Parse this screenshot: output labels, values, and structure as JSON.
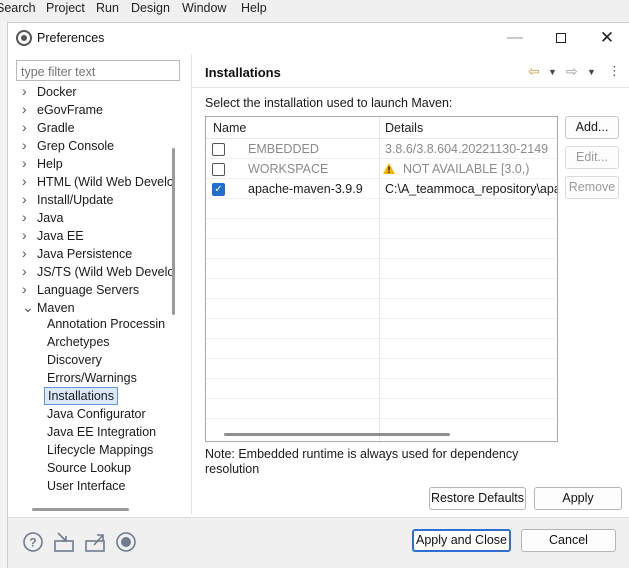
{
  "background_menu": [
    "Search",
    "Project",
    "Run",
    "Design",
    "Window",
    "Help"
  ],
  "window": {
    "title": "Preferences"
  },
  "filter": {
    "placeholder": "type filter text"
  },
  "tree": [
    {
      "label": "Docker",
      "expandable": true
    },
    {
      "label": "eGovFrame",
      "expandable": true
    },
    {
      "label": "Gradle",
      "expandable": true
    },
    {
      "label": "Grep Console",
      "expandable": true
    },
    {
      "label": "Help",
      "expandable": true
    },
    {
      "label": "HTML (Wild Web Develo",
      "expandable": true
    },
    {
      "label": "Install/Update",
      "expandable": true
    },
    {
      "label": "Java",
      "expandable": true
    },
    {
      "label": "Java EE",
      "expandable": true
    },
    {
      "label": "Java Persistence",
      "expandable": true
    },
    {
      "label": "JS/TS (Wild Web Develo",
      "expandable": true
    },
    {
      "label": "Language Servers",
      "expandable": true
    },
    {
      "label": "Maven",
      "expanded": true
    },
    {
      "label": "Annotation Processin",
      "child": true
    },
    {
      "label": "Archetypes",
      "child": true
    },
    {
      "label": "Discovery",
      "child": true
    },
    {
      "label": "Errors/Warnings",
      "child": true
    },
    {
      "label": "Installations",
      "child": true,
      "selected": true
    },
    {
      "label": "Java Configurator",
      "child": true
    },
    {
      "label": "Java EE Integration",
      "child": true
    },
    {
      "label": "Lifecycle Mappings",
      "child": true
    },
    {
      "label": "Source Lookup",
      "child": true
    },
    {
      "label": "User Interface",
      "child": true
    }
  ],
  "page": {
    "title": "Installations",
    "description": "Select the installation used to launch Maven:",
    "table": {
      "columns": [
        "Name",
        "Details"
      ],
      "rows": [
        {
          "checked": false,
          "name": "EMBEDDED",
          "details": "3.8.6/3.8.604.20221130-2149",
          "disabled": true
        },
        {
          "checked": false,
          "name": "WORKSPACE",
          "details": "NOT AVAILABLE [3.0,)",
          "disabled": true,
          "warning": true
        },
        {
          "checked": true,
          "name": "apache-maven-3.9.9",
          "details": "C:\\A_teammoca_repository\\apa",
          "disabled": false
        }
      ]
    },
    "buttons": {
      "add": "Add...",
      "edit": "Edit...",
      "remove": "Remove"
    },
    "note": "Note: Embedded runtime is always used for dependency resolution",
    "restore_defaults": "Restore Defaults",
    "apply": "Apply"
  },
  "footer": {
    "apply_and_close": "Apply and Close",
    "cancel": "Cancel",
    "icons": [
      "help-icon",
      "import-icon",
      "export-icon",
      "record-icon"
    ]
  },
  "colors": {
    "accent": "#2f6fd0",
    "selection": "#dbe9f8",
    "checkbox": "#1f6fd1"
  }
}
